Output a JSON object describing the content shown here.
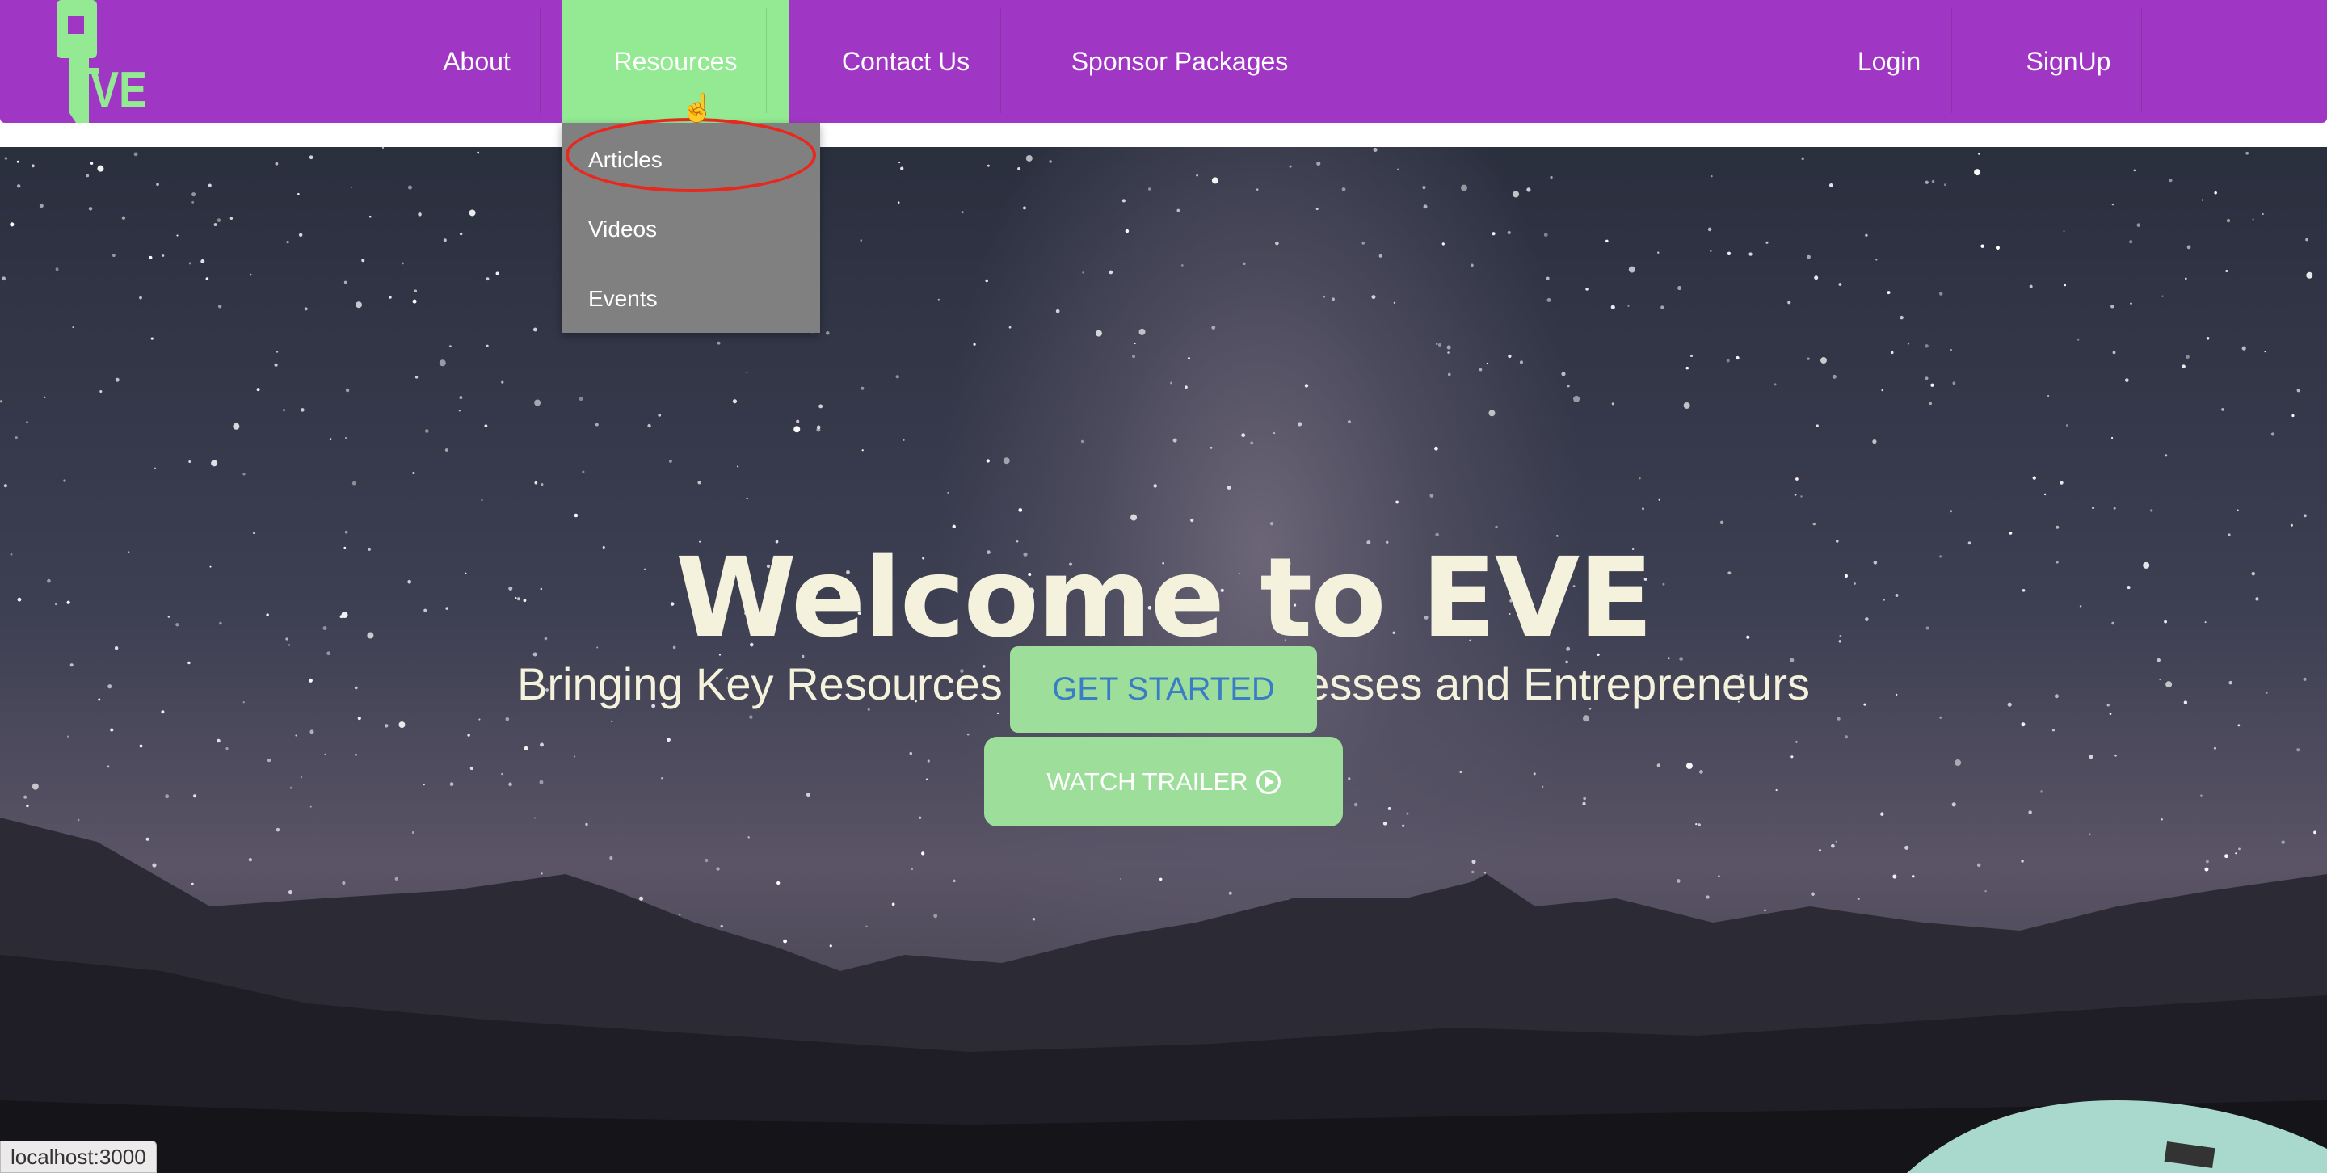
{
  "nav": {
    "logo_text": "EVE",
    "items": [
      {
        "label": "About"
      },
      {
        "label": "Resources",
        "active": true
      },
      {
        "label": "Contact Us"
      },
      {
        "label": "Sponsor Packages"
      }
    ],
    "login": "Login",
    "signup": "SignUp",
    "colors": {
      "bar": "#a037c4",
      "active": "#93ea93"
    }
  },
  "dropdown": {
    "items": [
      {
        "label": "Articles",
        "highlighted": true
      },
      {
        "label": "Videos"
      },
      {
        "label": "Events"
      }
    ]
  },
  "hero": {
    "title": "Welcome to EVE",
    "subtitle": "Bringing Key Resources to Small Businesses and Entrepreneurs",
    "get_started": "GET STARTED",
    "watch_trailer": "WATCH TRAILER",
    "watch_trailer_icon": "play-circle-icon"
  },
  "status_bar": {
    "url": "localhost:3000"
  }
}
